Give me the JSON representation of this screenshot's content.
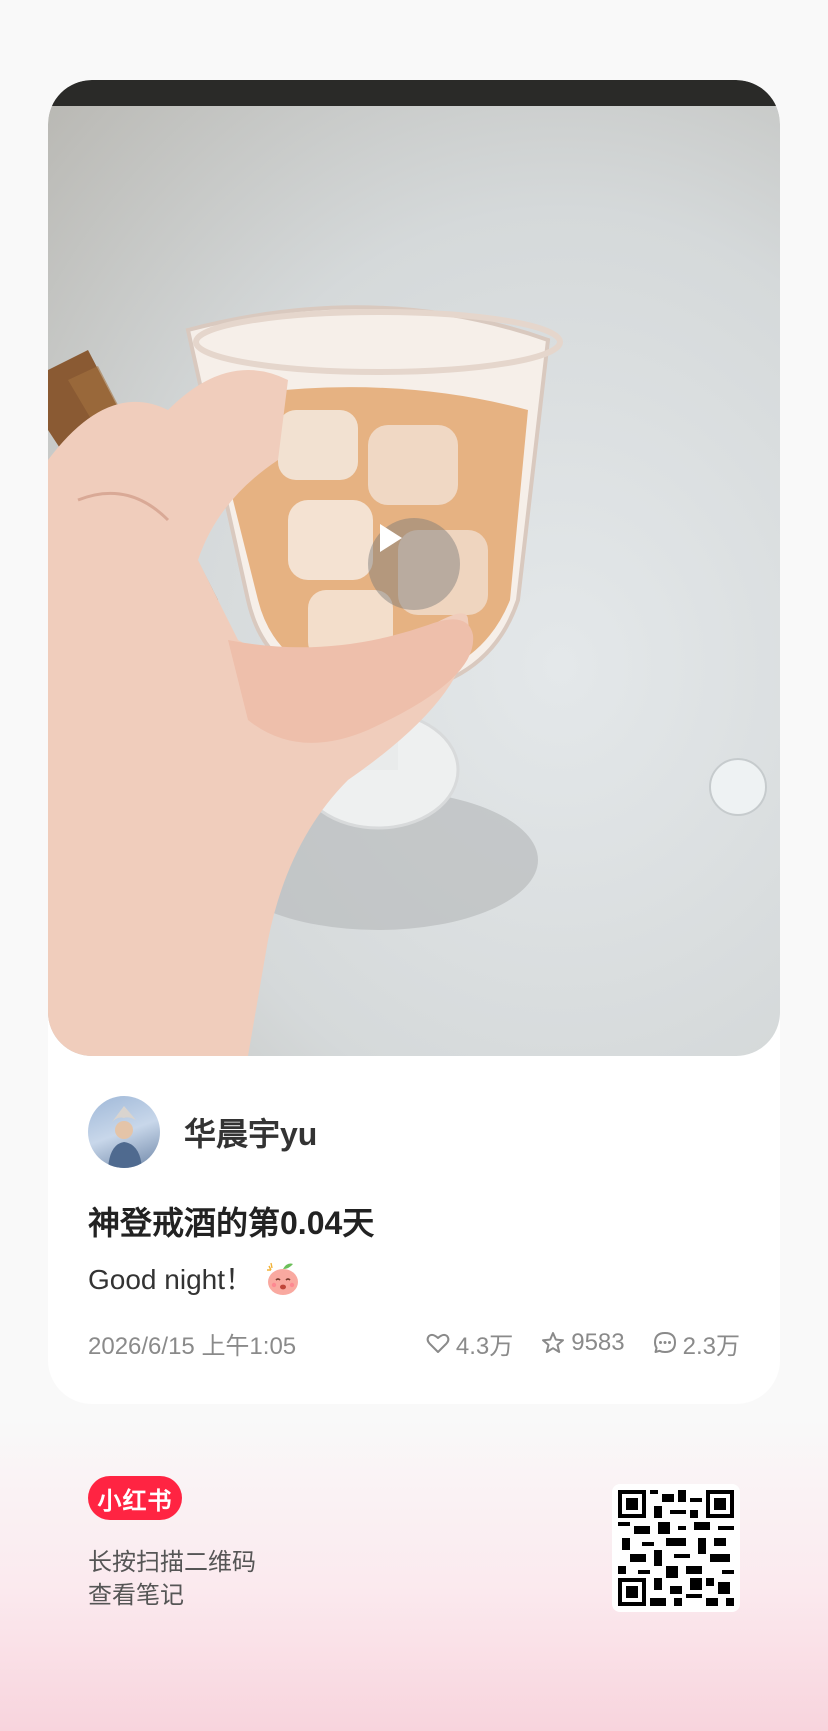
{
  "post": {
    "author_name": "华晨宇yu",
    "title": "神登戒酒的第0.04天",
    "description": "Good night！",
    "date": "2026/6/15 上午1:05",
    "likes": "4.3万",
    "favorites": "9583",
    "comments": "2.3万"
  },
  "footer": {
    "brand": "小红书",
    "scan_line1": "长按扫描二维码",
    "scan_line2": "查看笔记"
  },
  "icons": {
    "play": "play-icon",
    "like": "heart-icon",
    "favorite": "star-icon",
    "comment": "comment-icon",
    "qr": "qr-code"
  },
  "colors": {
    "brand_red": "#ff2442",
    "meta_gray": "#8a8a8a",
    "title_text": "#222222"
  }
}
